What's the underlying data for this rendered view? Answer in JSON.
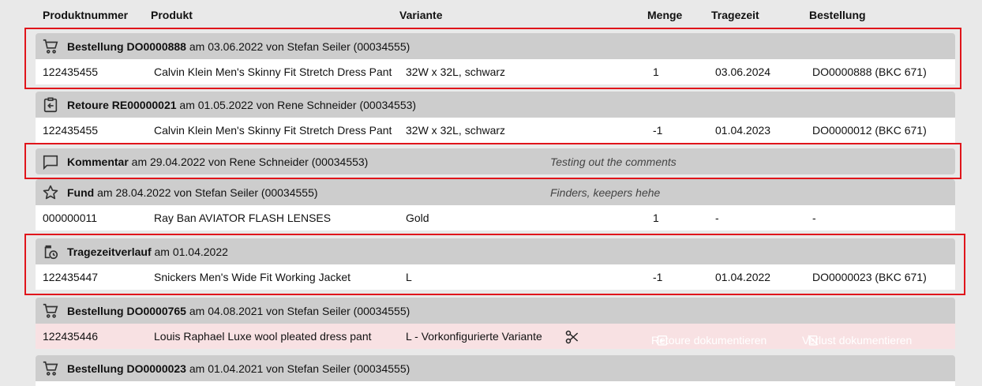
{
  "columns": {
    "produktnummer": "Produktnummer",
    "produkt": "Produkt",
    "variante": "Variante",
    "menge": "Menge",
    "tragezeit": "Tragezeit",
    "bestellung": "Bestellung"
  },
  "entries": [
    {
      "icon": "cart-icon",
      "title_bold": "Bestellung DO0000888",
      "title_rest": " am 03.06.2022 von Stefan Seiler (00034555)",
      "row": {
        "nummer": "122435455",
        "produkt": "Calvin Klein Men's Skinny Fit Stretch Dress Pant",
        "variante": "32W x 32L, schwarz",
        "menge": "1",
        "tragezeit": "03.06.2024",
        "bestellung": "DO0000888 (BKC 671)"
      }
    },
    {
      "icon": "return-icon",
      "title_bold": "Retoure RE00000021",
      "title_rest": " am 01.05.2022 von Rene Schneider (00034553)",
      "row": {
        "nummer": "122435455",
        "produkt": "Calvin Klein Men's Skinny Fit Stretch Dress Pant",
        "variante": "32W x 32L, schwarz",
        "menge": "-1",
        "tragezeit": "01.04.2023",
        "bestellung": "DO0000012 (BKC 671)"
      }
    },
    {
      "icon": "comment-icon",
      "title_bold": "Kommentar",
      "title_rest": " am 29.04.2022 von Rene Schneider (00034553)",
      "note": "Testing out the comments"
    },
    {
      "icon": "star-icon",
      "title_bold": "Fund",
      "title_rest": " am 28.04.2022 von Stefan Seiler (00034555)",
      "note": "Finders, keepers hehe",
      "row": {
        "nummer": "000000011",
        "produkt": "Ray Ban AVIATOR FLASH LENSES",
        "variante": "Gold",
        "menge": "1",
        "tragezeit": "-",
        "bestellung": "-"
      }
    },
    {
      "icon": "history-icon",
      "title_bold": "Tragezeitverlauf",
      "title_rest": " am 01.04.2022",
      "row": {
        "nummer": "122435447",
        "produkt": "Snickers Men's Wide Fit Working Jacket",
        "variante": "L",
        "menge": "-1",
        "tragezeit": "01.04.2022",
        "bestellung": "DO0000023 (BKC 671)"
      }
    },
    {
      "icon": "cart-icon",
      "title_bold": "Bestellung DO0000765",
      "title_rest": " am 04.08.2021 von Stefan Seiler (00034555)",
      "row": {
        "nummer": "122435446",
        "produkt": "Louis Raphael Luxe wool pleated dress pant",
        "variante": "L - Vorkonfigurierte Variante"
      },
      "actions": {
        "retoure": "Retoure dokumentieren",
        "verlust": "Verlust dokumentieren"
      }
    },
    {
      "icon": "cart-icon",
      "title_bold": "Bestellung DO0000023",
      "title_rest": " am 01.04.2021 von Stefan Seiler (00034555)"
    }
  ],
  "colors": {
    "highlight": "#e0151b",
    "header_bar": "#cdcdcd",
    "lost_row": "#f8e1e3",
    "button": "#555555"
  }
}
